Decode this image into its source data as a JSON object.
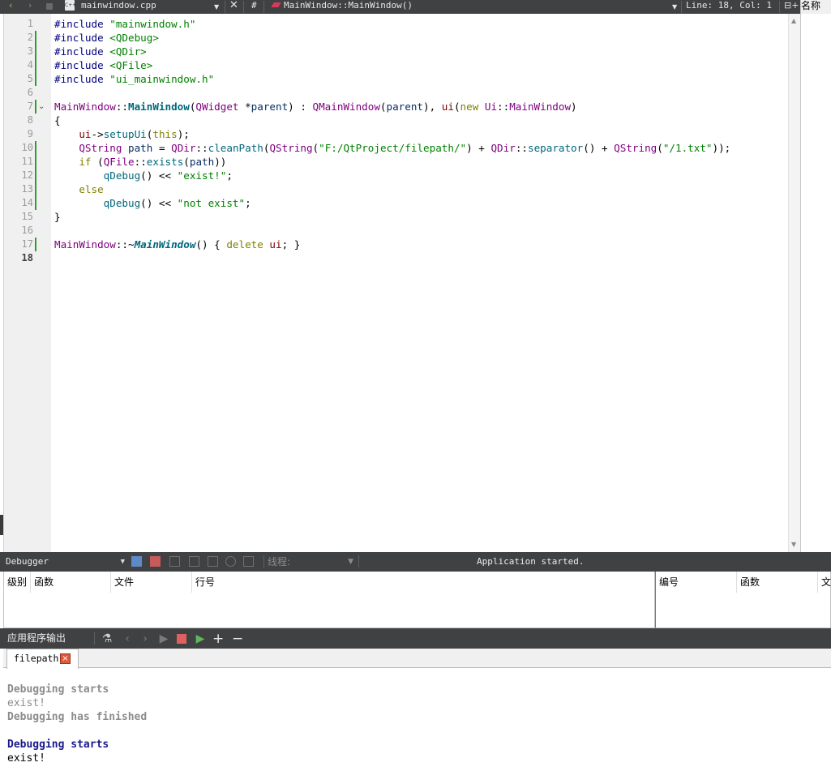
{
  "toolbar": {
    "back_icon": "‹",
    "forward_icon": "›",
    "file_icon_text": "C++",
    "file_name": "mainwindow.cpp",
    "hash": "#",
    "symbol": "MainWindow::MainWindow()",
    "cursor_pos": "Line: 18, Col: 1",
    "split_icon": "⊟+"
  },
  "right_pane": {
    "header": "名称"
  },
  "editor": {
    "current_line": 18,
    "changed_lines": [
      2,
      3,
      4,
      5,
      7,
      10,
      11,
      12,
      13,
      14,
      17
    ],
    "fold_line": 7,
    "lines": [
      {
        "n": 1,
        "tokens": [
          [
            "t-pre",
            "#include "
          ],
          [
            "t-str",
            "\"mainwindow.h\""
          ]
        ]
      },
      {
        "n": 2,
        "tokens": [
          [
            "t-pre",
            "#include "
          ],
          [
            "t-inc",
            "<QDebug>"
          ]
        ]
      },
      {
        "n": 3,
        "tokens": [
          [
            "t-pre",
            "#include "
          ],
          [
            "t-inc",
            "<QDir>"
          ]
        ]
      },
      {
        "n": 4,
        "tokens": [
          [
            "t-pre",
            "#include "
          ],
          [
            "t-inc",
            "<QFile>"
          ]
        ]
      },
      {
        "n": 5,
        "tokens": [
          [
            "t-pre",
            "#include "
          ],
          [
            "t-str",
            "\"ui_mainwindow.h\""
          ]
        ]
      },
      {
        "n": 6,
        "tokens": []
      },
      {
        "n": 7,
        "tokens": [
          [
            "t-cls",
            "MainWindow"
          ],
          [
            "t-pln",
            "::"
          ],
          [
            "t-fnb",
            "MainWindow"
          ],
          [
            "t-pln",
            "("
          ],
          [
            "t-cls",
            "QWidget"
          ],
          [
            "t-pln",
            " *"
          ],
          [
            "t-var",
            "parent"
          ],
          [
            "t-pln",
            ") : "
          ],
          [
            "t-cls",
            "QMainWindow"
          ],
          [
            "t-pln",
            "("
          ],
          [
            "t-var",
            "parent"
          ],
          [
            "t-pln",
            "), "
          ],
          [
            "t-mem",
            "ui"
          ],
          [
            "t-pln",
            "("
          ],
          [
            "t-kw",
            "new "
          ],
          [
            "t-cls",
            "Ui"
          ],
          [
            "t-pln",
            "::"
          ],
          [
            "t-cls",
            "MainWindow"
          ],
          [
            "t-pln",
            ")"
          ]
        ]
      },
      {
        "n": 8,
        "tokens": [
          [
            "t-pln",
            "{"
          ]
        ]
      },
      {
        "n": 9,
        "tokens": [
          [
            "t-pln",
            "    "
          ],
          [
            "t-mem",
            "ui"
          ],
          [
            "t-pln",
            "->"
          ],
          [
            "t-fn",
            "setupUi"
          ],
          [
            "t-pln",
            "("
          ],
          [
            "t-kw",
            "this"
          ],
          [
            "t-pln",
            ");"
          ]
        ]
      },
      {
        "n": 10,
        "tokens": [
          [
            "t-pln",
            "    "
          ],
          [
            "t-cls",
            "QString"
          ],
          [
            "t-pln",
            " "
          ],
          [
            "t-var",
            "path"
          ],
          [
            "t-pln",
            " = "
          ],
          [
            "t-cls",
            "QDir"
          ],
          [
            "t-pln",
            "::"
          ],
          [
            "t-fn",
            "cleanPath"
          ],
          [
            "t-pln",
            "("
          ],
          [
            "t-cls",
            "QString"
          ],
          [
            "t-pln",
            "("
          ],
          [
            "t-str",
            "\"F:/QtProject/filepath/\""
          ],
          [
            "t-pln",
            ") + "
          ],
          [
            "t-cls",
            "QDir"
          ],
          [
            "t-pln",
            "::"
          ],
          [
            "t-fn",
            "separator"
          ],
          [
            "t-pln",
            "() + "
          ],
          [
            "t-cls",
            "QString"
          ],
          [
            "t-pln",
            "("
          ],
          [
            "t-str",
            "\"/1.txt\""
          ],
          [
            "t-pln",
            "));"
          ]
        ]
      },
      {
        "n": 11,
        "tokens": [
          [
            "t-pln",
            "    "
          ],
          [
            "t-kw",
            "if"
          ],
          [
            "t-pln",
            " ("
          ],
          [
            "t-cls",
            "QFile"
          ],
          [
            "t-pln",
            "::"
          ],
          [
            "t-fn",
            "exists"
          ],
          [
            "t-pln",
            "("
          ],
          [
            "t-var",
            "path"
          ],
          [
            "t-pln",
            "))"
          ]
        ]
      },
      {
        "n": 12,
        "tokens": [
          [
            "t-pln",
            "        "
          ],
          [
            "t-fn",
            "qDebug"
          ],
          [
            "t-pln",
            "() << "
          ],
          [
            "t-str",
            "\"exist!\""
          ],
          [
            "t-pln",
            ";"
          ]
        ]
      },
      {
        "n": 13,
        "tokens": [
          [
            "t-pln",
            "    "
          ],
          [
            "t-kw",
            "else"
          ]
        ]
      },
      {
        "n": 14,
        "tokens": [
          [
            "t-pln",
            "        "
          ],
          [
            "t-fn",
            "qDebug"
          ],
          [
            "t-pln",
            "() << "
          ],
          [
            "t-str",
            "\"not exist\""
          ],
          [
            "t-pln",
            ";"
          ]
        ]
      },
      {
        "n": 15,
        "tokens": [
          [
            "t-pln",
            "}"
          ]
        ]
      },
      {
        "n": 16,
        "tokens": []
      },
      {
        "n": 17,
        "tokens": [
          [
            "t-cls",
            "MainWindow"
          ],
          [
            "t-pln",
            "::~"
          ],
          [
            "t-fni",
            "MainWindow"
          ],
          [
            "t-pln",
            "() { "
          ],
          [
            "t-kw",
            "delete"
          ],
          [
            "t-pln",
            " "
          ],
          [
            "t-mem",
            "ui"
          ],
          [
            "t-pln",
            "; }"
          ]
        ]
      },
      {
        "n": 18,
        "tokens": []
      }
    ]
  },
  "debugger": {
    "mode": "Debugger",
    "thread_label": "线程:",
    "status": "Application started."
  },
  "stack": {
    "columns": [
      "级别",
      "函数",
      "文件",
      "行号"
    ]
  },
  "breakpoints": {
    "columns": [
      "编号",
      "函数",
      "文"
    ]
  },
  "output_pane": {
    "title": "应用程序输出",
    "tab_label": "filepath",
    "tab_close": "×",
    "lines": [
      {
        "cls": "o-dim-b",
        "text": ""
      },
      {
        "cls": "o-dim-b",
        "text": "Debugging starts"
      },
      {
        "cls": "o-dim",
        "text": "exist!"
      },
      {
        "cls": "o-dim-b",
        "text": "Debugging has finished"
      },
      {
        "cls": "o-norm",
        "text": ""
      },
      {
        "cls": "o-blue-b",
        "text": "Debugging starts"
      },
      {
        "cls": "o-norm",
        "text": "exist!"
      }
    ]
  },
  "colors": {
    "dark_bar": "#404142",
    "string_green": "#008000",
    "class_purple": "#800080",
    "keyword_olive": "#808000",
    "change_marker": "#2e9e2e"
  }
}
